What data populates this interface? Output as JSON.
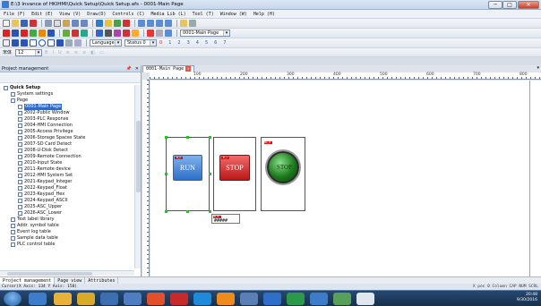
{
  "window": {
    "title": "E:\\3 Invance of HKIHMI\\Quick Setup\\Quick Setup.afs - 0001-Main Page",
    "minimize": "─",
    "maximize": "□",
    "close": "✕"
  },
  "menu": [
    "File (F)",
    "Edit (E)",
    "View (V)",
    "Draw(D)",
    "Controls (C)",
    "Media Lib (L)",
    "Tool (T)",
    "Window (W)",
    "Help (H)"
  ],
  "toolbar": {
    "page_select": "0001-Main Page",
    "language_select": "Language 1",
    "status_select": "Status 0",
    "status_numbers": [
      "0",
      "1",
      "2",
      "3",
      "4",
      "5",
      "6",
      "7"
    ],
    "font_size": "12",
    "font_label": "宋体"
  },
  "project_panel": {
    "title": "Project management",
    "pin": "📌",
    "close": "✕",
    "tree": [
      {
        "label": "Quick Setup",
        "level": 0
      },
      {
        "label": "System settings",
        "level": 1
      },
      {
        "label": "Page",
        "level": 1
      },
      {
        "label": "0001-Main Page",
        "level": 2,
        "selected": true
      },
      {
        "label": "2002-Public Window",
        "level": 2
      },
      {
        "label": "2003-PLC Response",
        "level": 2
      },
      {
        "label": "2004-HMI Connection",
        "level": 2
      },
      {
        "label": "2005-Access Privilege",
        "level": 2
      },
      {
        "label": "2006-Storage Spaces State",
        "level": 2
      },
      {
        "label": "2007-SD Card Detect",
        "level": 2
      },
      {
        "label": "2008-U-Disk Detect",
        "level": 2
      },
      {
        "label": "2009-Remote Connection",
        "level": 2
      },
      {
        "label": "2010-Input State",
        "level": 2
      },
      {
        "label": "2011-Remote device",
        "level": 2
      },
      {
        "label": "2012-HMI System Set",
        "level": 2
      },
      {
        "label": "2021-Keypad_Integer",
        "level": 2
      },
      {
        "label": "2022-Keypad_Float",
        "level": 2
      },
      {
        "label": "2023-Keypad_Hex",
        "level": 2
      },
      {
        "label": "2024-Keypad_ASCII",
        "level": 2
      },
      {
        "label": "2025-ASC_Upper",
        "level": 2
      },
      {
        "label": "2026-ASC_Lower",
        "level": 2
      },
      {
        "label": "Text label library",
        "level": 1
      },
      {
        "label": "Addr. symbol table",
        "level": 1
      },
      {
        "label": "Event log table",
        "level": 1
      },
      {
        "label": "Sample data table",
        "level": 1
      },
      {
        "label": "PLC control table",
        "level": 1
      }
    ]
  },
  "bottom_tabs": [
    "Project management",
    "Page view",
    "Attributes"
  ],
  "status_bar": {
    "left": "Cursor(X Axis: 134 Y Axis: 158)",
    "right": "X pos 0  Column  CAP  NUM  SCRL"
  },
  "document": {
    "tab": "0001-Main Page",
    "tab_close": "✕",
    "ruler_labels": [
      "100",
      "200",
      "300",
      "400",
      "500",
      "600",
      "700",
      "800"
    ],
    "buttons": {
      "run": "RUN",
      "stop": "STOP",
      "lamp_tag": "BL_0",
      "run_tag": "B_0",
      "stop_tag": "B_1",
      "numeric": "#####",
      "numeric_tag": "W_0"
    }
  },
  "taskbar": {
    "time": "20:48",
    "date": "9/30/2016"
  }
}
